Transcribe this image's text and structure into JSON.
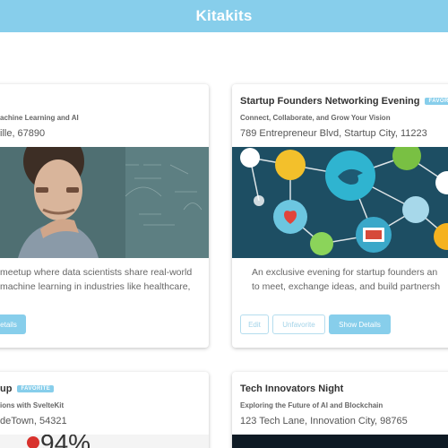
{
  "header": {
    "title": "Kitakits"
  },
  "cards": [
    {
      "title": "",
      "subtitle": "achine Learning and AI",
      "address": "ille, 67890",
      "description": [
        "meetup where data scientists share real-world",
        "machine learning in industries like healthcare,"
      ],
      "buttons": {
        "details": "etails"
      }
    },
    {
      "title": "Startup Founders Networking Evening",
      "badge": "FAVORITE",
      "subtitle": "Connect, Collaborate, and Grow Your Vision",
      "address": "789 Entrepreneur Blvd, Startup City, 11223",
      "description": [
        "An exclusive evening for startup founders an",
        "to meet, exchange ideas, and build partnersh"
      ],
      "buttons": {
        "edit": "Edit",
        "unfavorite": "Unfavorite",
        "details": "Show Details"
      }
    },
    {
      "title": "up",
      "badge": "FAVORITE",
      "subtitle": "ions with SvelteKit",
      "address": "deTown, 54321",
      "image_text": "94%"
    },
    {
      "title": "Tech Innovators Night",
      "subtitle": "Exploring the Future of AI and Blockchain",
      "address": "123 Tech Lane, Innovation City, 98765"
    }
  ],
  "colors": {
    "accent": "#87ceeb",
    "button_outline_text": "#a3d3e8"
  }
}
